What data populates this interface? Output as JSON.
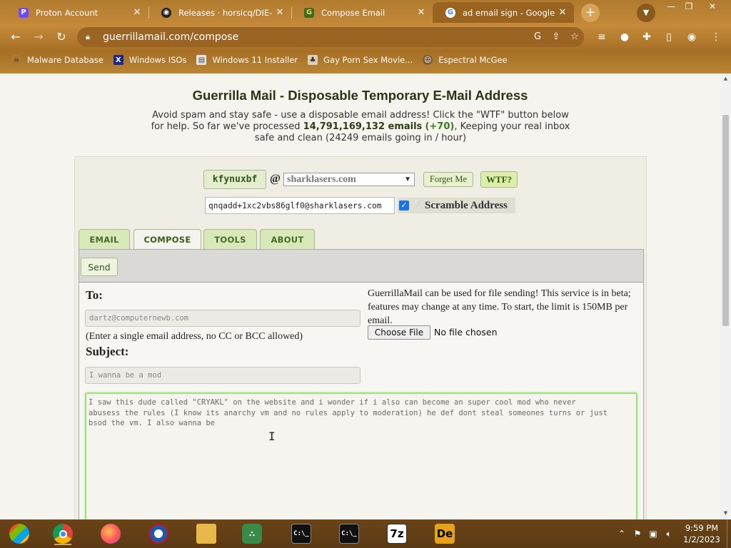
{
  "browser": {
    "tabs": [
      {
        "title": "Proton Account",
        "icon": "proton-icon",
        "active": false
      },
      {
        "title": "Releases · horsicq/DIE-en",
        "icon": "github-icon",
        "active": false
      },
      {
        "title": "Compose Email",
        "icon": "guerrillamail-icon",
        "active": false
      },
      {
        "title": "ad email sign - Google Sea",
        "icon": "google-icon",
        "active": true
      }
    ],
    "new_tab_symbol": "+",
    "url": "guerrillamail.com/compose",
    "bookmarks": [
      {
        "label": "Malware Database",
        "icon": "skull-icon"
      },
      {
        "label": "Windows ISOs",
        "icon": "x-icon"
      },
      {
        "label": "Windows 11 Installer",
        "icon": "installer-icon"
      },
      {
        "label": "Gay Porn Sex Movie...",
        "icon": "site-icon"
      },
      {
        "label": "Espectral McGee",
        "icon": "avatar-icon"
      }
    ]
  },
  "page": {
    "headline": "Guerrilla Mail - Disposable Temporary E-Mail Address",
    "intro_part1": "Avoid spam and stay safe - use a disposable email address! Click the \"WTF\" button below for help. So far we've processed ",
    "emails_processed": "14,791,169,132 emails",
    "emails_delta": "(+70)",
    "intro_part2": ", Keeping your real inbox safe and clean (24249 emails going in / hour)",
    "username": "kfynuxbf",
    "at_symbol": "@",
    "domain": "sharklasers.com",
    "forget_label": "Forget Me",
    "wtf_label": "WTF?",
    "scrambled_address": "qnqadd+1xc2vbs86glf0@sharklasers.com",
    "scramble_label": "Scramble Address",
    "scramble_checked": true,
    "tabs": [
      "EMAIL",
      "COMPOSE",
      "TOOLS",
      "ABOUT"
    ],
    "active_tab": "COMPOSE",
    "send_label": "Send",
    "to_label": "To:",
    "to_value": "dartz@computernewb.com",
    "to_note": "(Enter a single email address, no CC or BCC allowed)",
    "subject_label": "Subject:",
    "subject_value": "I wanna be a mod",
    "file_note": "GuerrillaMail can be used for file sending! This service is in beta; features may change at any time. To start, the limit is 150MB per email.",
    "choose_file_label": "Choose File",
    "no_file_label": "No file chosen",
    "body_text": "I saw this dude called \"CRYAKL\" on the website and i wonder if i also can become an super cool mod who never\nabusess the rules (I know its anarchy vm and no rules apply to moderation) he def dont steal someones turns or just\nbsod the vm. I also wanna be"
  },
  "taskbar": {
    "apps": [
      "windows-start",
      "chrome",
      "firefox",
      "obama-app",
      "file-explorer",
      "network-app",
      "cmd-1",
      "cmd-2",
      "7zip",
      "die"
    ],
    "cmd_label": "C:\\_",
    "sevenzip_label": "7z",
    "die_label": "De",
    "time": "9:59 PM",
    "date": "1/2/2023"
  },
  "colors": {
    "chrome_bg": "#b07a2e",
    "accent_green": "#2f5a14",
    "tab_green": "#d8e8b8",
    "body_border": "#9be07a"
  }
}
